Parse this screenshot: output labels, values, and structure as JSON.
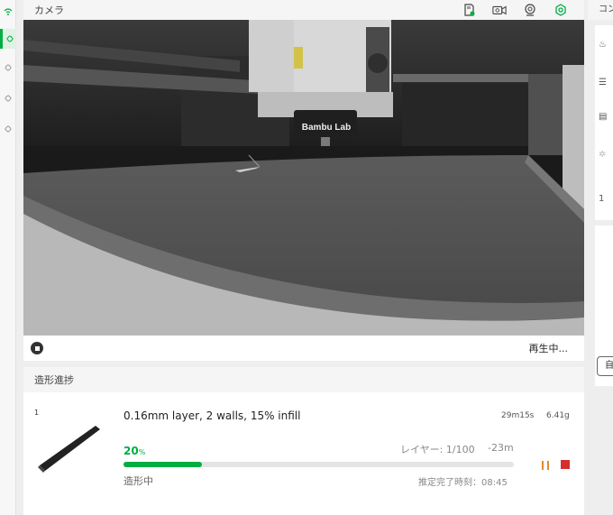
{
  "camera": {
    "title": "カメラ",
    "play_status": "再生中...",
    "icons": [
      "sd-card-icon",
      "video-camera-icon",
      "webcam-icon",
      "settings-gear-icon"
    ],
    "brand_text": "Bambu Lab"
  },
  "progress": {
    "header": "造形進捗",
    "plate_number": "1",
    "job_name": "0.16mm layer, 2 walls, 15% infill",
    "time": "29m15s",
    "weight": "6.41g",
    "percent_value": "20",
    "percent_sign": "%",
    "percent_fraction": 0.2,
    "layers": "レイヤー: 1/100",
    "remaining": "-23m",
    "status": "造形中",
    "eta": "推定完了時刻：08:45"
  },
  "right_panel": {
    "header": "コン",
    "value": "1",
    "button": "自"
  },
  "colors": {
    "accent": "#00ae42",
    "pause": "#e38a2a",
    "stop": "#d62d2d"
  }
}
